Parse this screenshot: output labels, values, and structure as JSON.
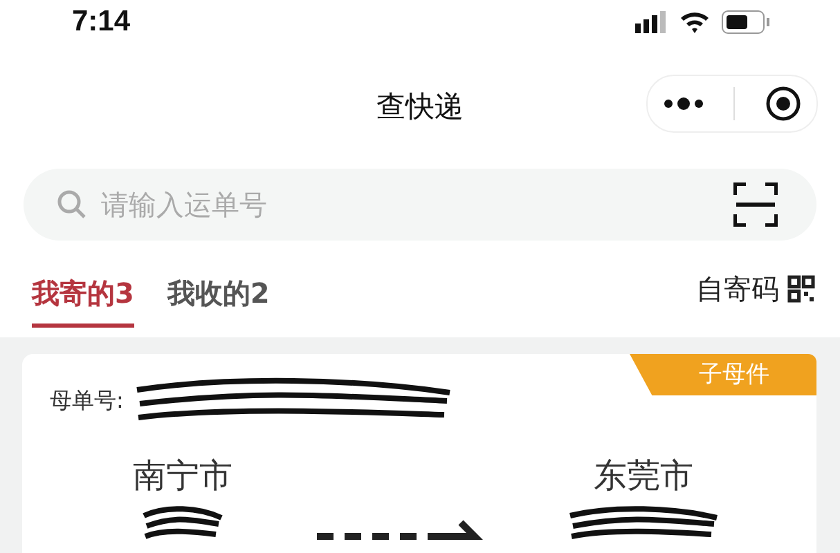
{
  "status_bar": {
    "time": "7:14"
  },
  "nav": {
    "title": "查快递"
  },
  "search": {
    "placeholder": "请输入运单号"
  },
  "tabs": [
    {
      "label": "我寄的3",
      "selected": true
    },
    {
      "label": "我收的2",
      "selected": false
    }
  ],
  "self_send_code": {
    "label": "自寄码"
  },
  "shipment": {
    "badge": "子母件",
    "number_label": "母单号:",
    "origin": "南宁市",
    "destination": "东莞市"
  }
}
